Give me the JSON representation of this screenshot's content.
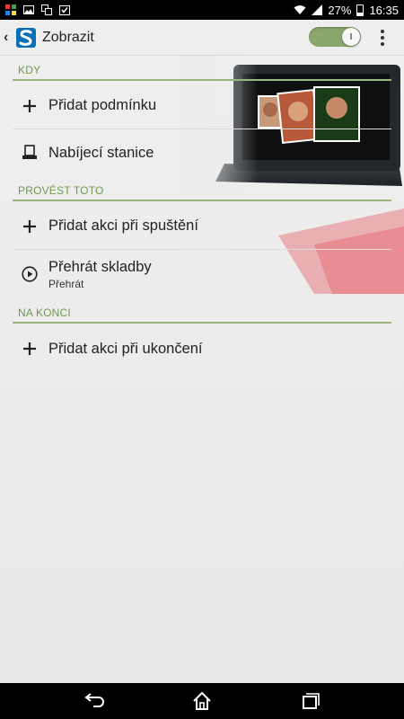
{
  "status": {
    "battery_percent": "27%",
    "time": "16:35"
  },
  "header": {
    "back_icon": "chevron-left-icon",
    "app_icon": "smart-connect-s-icon",
    "title": "Zobrazit",
    "toggle_on": true,
    "overflow_icon": "overflow-menu-icon"
  },
  "sections": {
    "when": {
      "heading": "KDY",
      "add_label": "Přidat podmínku",
      "item_label": "Nabíjecí stanice",
      "item_icon": "dock-station-icon"
    },
    "do": {
      "heading": "PROVÉST TOTO",
      "add_label": "Přidat akci při spuštění",
      "item_label": "Přehrát skladby",
      "item_sub": "Přehrát",
      "item_icon": "play-circle-icon"
    },
    "end": {
      "heading": "NA KONCI",
      "add_label": "Přidat akci při ukončení"
    }
  },
  "colors": {
    "accent_green": "#6f9a4e",
    "divider_green": "#97b67d",
    "toggle_green": "#8aa66d",
    "background": "#ececec"
  }
}
